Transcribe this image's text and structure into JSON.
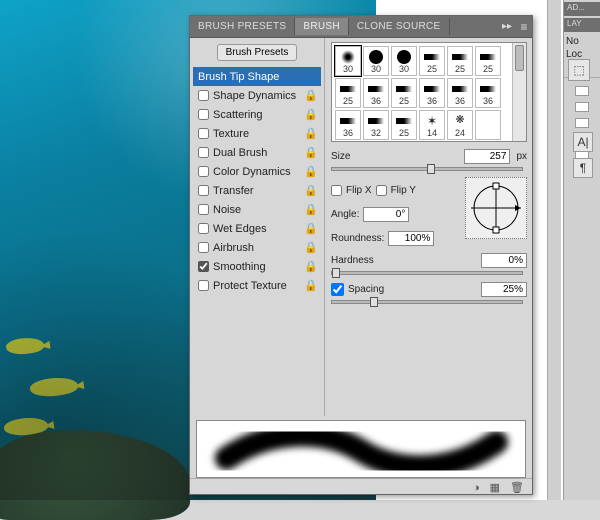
{
  "tabs": {
    "presets": "BRUSH PRESETS",
    "brush": "BRUSH",
    "clone": "CLONE SOURCE"
  },
  "presetButton": "Brush Presets",
  "options": [
    {
      "label": "Brush Tip Shape",
      "checkbox": false,
      "selected": true
    },
    {
      "label": "Shape Dynamics",
      "checkbox": true,
      "checked": false
    },
    {
      "label": "Scattering",
      "checkbox": true,
      "checked": false
    },
    {
      "label": "Texture",
      "checkbox": true,
      "checked": false
    },
    {
      "label": "Dual Brush",
      "checkbox": true,
      "checked": false
    },
    {
      "label": "Color Dynamics",
      "checkbox": true,
      "checked": false
    },
    {
      "label": "Transfer",
      "checkbox": true,
      "checked": false
    },
    {
      "label": "Noise",
      "checkbox": true,
      "checked": false
    },
    {
      "label": "Wet Edges",
      "checkbox": true,
      "checked": false
    },
    {
      "label": "Airbrush",
      "checkbox": true,
      "checked": false
    },
    {
      "label": "Smoothing",
      "checkbox": true,
      "checked": true
    },
    {
      "label": "Protect Texture",
      "checkbox": true,
      "checked": false
    }
  ],
  "thumbs": [
    [
      "30",
      "30",
      "30",
      "25",
      "25",
      "25"
    ],
    [
      "25",
      "36",
      "25",
      "36",
      "36",
      "36"
    ],
    [
      "36",
      "32",
      "25",
      "14",
      "24",
      ""
    ]
  ],
  "size": {
    "label": "Size",
    "value": "257",
    "unit": "px",
    "sliderPos": 52
  },
  "flip": {
    "xLabel": "Flip X",
    "yLabel": "Flip Y"
  },
  "angle": {
    "label": "Angle:",
    "value": "0°"
  },
  "roundness": {
    "label": "Roundness:",
    "value": "100%"
  },
  "hardness": {
    "label": "Hardness",
    "value": "0%",
    "sliderPos": 2
  },
  "spacing": {
    "label": "Spacing",
    "value": "25%",
    "checked": true,
    "sliderPos": 22
  },
  "dockLabels": {
    "adj": "AD...",
    "layers": "LAY",
    "normal": "No",
    "lock": "Loc"
  },
  "toolGlyphs": {
    "a": "A|",
    "para": "¶"
  }
}
